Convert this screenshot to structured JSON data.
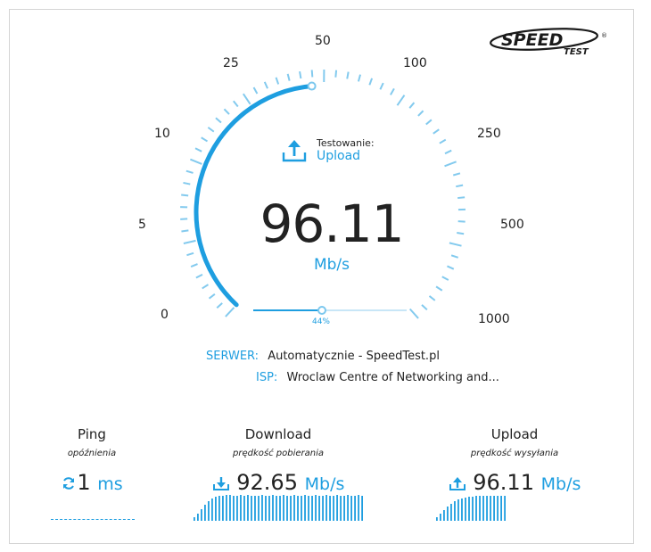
{
  "logo": {
    "brand": "SPEED",
    "sub": "TEST",
    "mark": "®"
  },
  "gauge": {
    "scale_labels": [
      "0",
      "5",
      "10",
      "25",
      "50",
      "100",
      "250",
      "500",
      "1000"
    ],
    "testing_label": "Testowanie:",
    "testing_value": "Upload",
    "speed": "96.11",
    "unit": "Mb/s",
    "progress_fraction": 0.44,
    "progress_label": "44%",
    "accent_color": "#1e9ee0"
  },
  "server": {
    "server_key": "SERWER:",
    "server_value": "Automatycznie - SpeedTest.pl",
    "isp_key": "ISP:",
    "isp_value": "Wroclaw Centre of Networking and..."
  },
  "stats": {
    "ping": {
      "title": "Ping",
      "subtitle": "opóźnienia",
      "value": "1",
      "unit": "ms",
      "icon": "refresh-icon"
    },
    "download": {
      "title": "Download",
      "subtitle": "prędkość pobierania",
      "value": "92.65",
      "unit": "Mb/s",
      "icon": "download-icon"
    },
    "upload": {
      "title": "Upload",
      "subtitle": "prędkość wysyłania",
      "value": "96.11",
      "unit": "Mb/s",
      "icon": "upload-icon"
    }
  }
}
